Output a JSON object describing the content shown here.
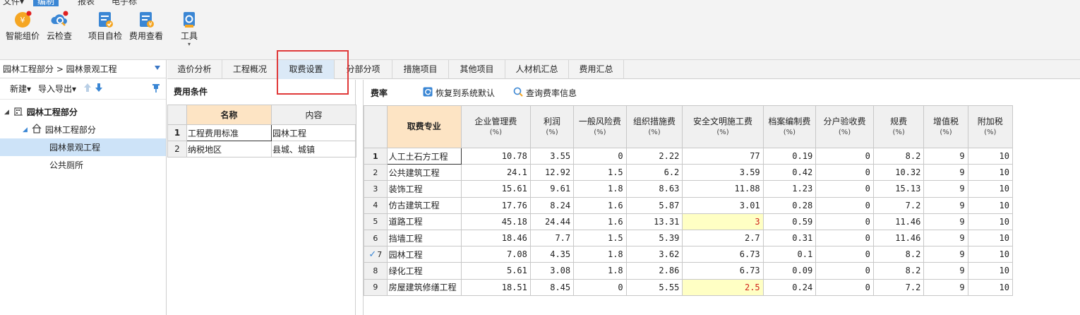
{
  "menu": {
    "items": [
      {
        "label": "文件▾"
      },
      {
        "label": "编制",
        "active": true
      },
      {
        "label": "报表"
      },
      {
        "label": "电子标"
      }
    ]
  },
  "ribbon": {
    "buttons": [
      {
        "label": "智能组价",
        "icon": "smart-pricing-icon"
      },
      {
        "label": "云检查",
        "icon": "cloud-check-icon"
      },
      {
        "label": "项目自检",
        "icon": "project-self-check-icon"
      },
      {
        "label": "费用查看",
        "icon": "fee-view-icon"
      },
      {
        "label": "工具",
        "icon": "tools-icon",
        "caret": "▾"
      }
    ]
  },
  "left": {
    "breadcrumb": "园林工程部分 > 园林景观工程",
    "tools": {
      "new": "新建▾",
      "import_export": "导入导出▾",
      "pin": "⊤"
    },
    "tree": [
      {
        "label": "园林工程部分",
        "level": 0,
        "bold": true,
        "expanded": true
      },
      {
        "label": "园林工程部分",
        "level": 1,
        "expanded": true
      },
      {
        "label": "园林景观工程",
        "level": 2,
        "selected": true
      },
      {
        "label": "公共厕所",
        "level": 2
      }
    ]
  },
  "tabs": [
    {
      "label": "造价分析"
    },
    {
      "label": "工程概况"
    },
    {
      "label": "取费设置",
      "active": true
    },
    {
      "label": "分部分项"
    },
    {
      "label": "措施项目"
    },
    {
      "label": "其他项目"
    },
    {
      "label": "人材机汇总"
    },
    {
      "label": "费用汇总"
    }
  ],
  "conditions": {
    "title": "费用条件",
    "headers": [
      "名称",
      "内容"
    ],
    "rows": [
      {
        "idx": "1",
        "name": "工程费用标准",
        "value": "园林工程"
      },
      {
        "idx": "2",
        "name": "纳税地区",
        "value": "县城、城镇"
      }
    ]
  },
  "rates": {
    "title": "费率",
    "restore_label": "恢复到系统默认",
    "query_label": "查询费率信息",
    "pct": "(%)",
    "headers": [
      "取费专业",
      "企业管理费",
      "利润",
      "一般风险费",
      "组织措施费",
      "安全文明施工费",
      "档案编制费",
      "分户验收费",
      "规费",
      "增值税",
      "附加税"
    ],
    "rows": [
      {
        "idx": "1",
        "name": "人工土石方工程",
        "v": [
          "10.78",
          "3.55",
          "0",
          "2.22",
          "77",
          "0.19",
          "0",
          "8.2",
          "9",
          "10"
        ]
      },
      {
        "idx": "2",
        "name": "公共建筑工程",
        "v": [
          "24.1",
          "12.92",
          "1.5",
          "6.2",
          "3.59",
          "0.42",
          "0",
          "10.32",
          "9",
          "10"
        ]
      },
      {
        "idx": "3",
        "name": "装饰工程",
        "v": [
          "15.61",
          "9.61",
          "1.8",
          "8.63",
          "11.88",
          "1.23",
          "0",
          "15.13",
          "9",
          "10"
        ]
      },
      {
        "idx": "4",
        "name": "仿古建筑工程",
        "v": [
          "17.76",
          "8.24",
          "1.6",
          "5.87",
          "3.01",
          "0.28",
          "0",
          "7.2",
          "9",
          "10"
        ]
      },
      {
        "idx": "5",
        "name": "道路工程",
        "v": [
          "45.18",
          "24.44",
          "1.6",
          "13.31",
          "3",
          "0.59",
          "0",
          "11.46",
          "9",
          "10"
        ],
        "hl": 4
      },
      {
        "idx": "6",
        "name": "挡墙工程",
        "v": [
          "18.46",
          "7.7",
          "1.5",
          "5.39",
          "2.7",
          "0.31",
          "0",
          "11.46",
          "9",
          "10"
        ]
      },
      {
        "idx": "7",
        "name": "园林工程",
        "v": [
          "7.08",
          "4.35",
          "1.8",
          "3.62",
          "6.73",
          "0.1",
          "0",
          "8.2",
          "9",
          "10"
        ],
        "checked": true
      },
      {
        "idx": "8",
        "name": "绿化工程",
        "v": [
          "5.61",
          "3.08",
          "1.8",
          "2.86",
          "6.73",
          "0.09",
          "0",
          "8.2",
          "9",
          "10"
        ]
      },
      {
        "idx": "9",
        "name": "房屋建筑修缮工程",
        "v": [
          "18.51",
          "8.45",
          "0",
          "5.55",
          "2.5",
          "0.24",
          "0",
          "7.2",
          "9",
          "10"
        ],
        "hl": 4
      }
    ]
  },
  "colors": {
    "accent": "#3a86d4",
    "highlight_cell": "#ffffc4",
    "annotation_box": "#e03a3a",
    "header_active": "#fde4c4"
  }
}
